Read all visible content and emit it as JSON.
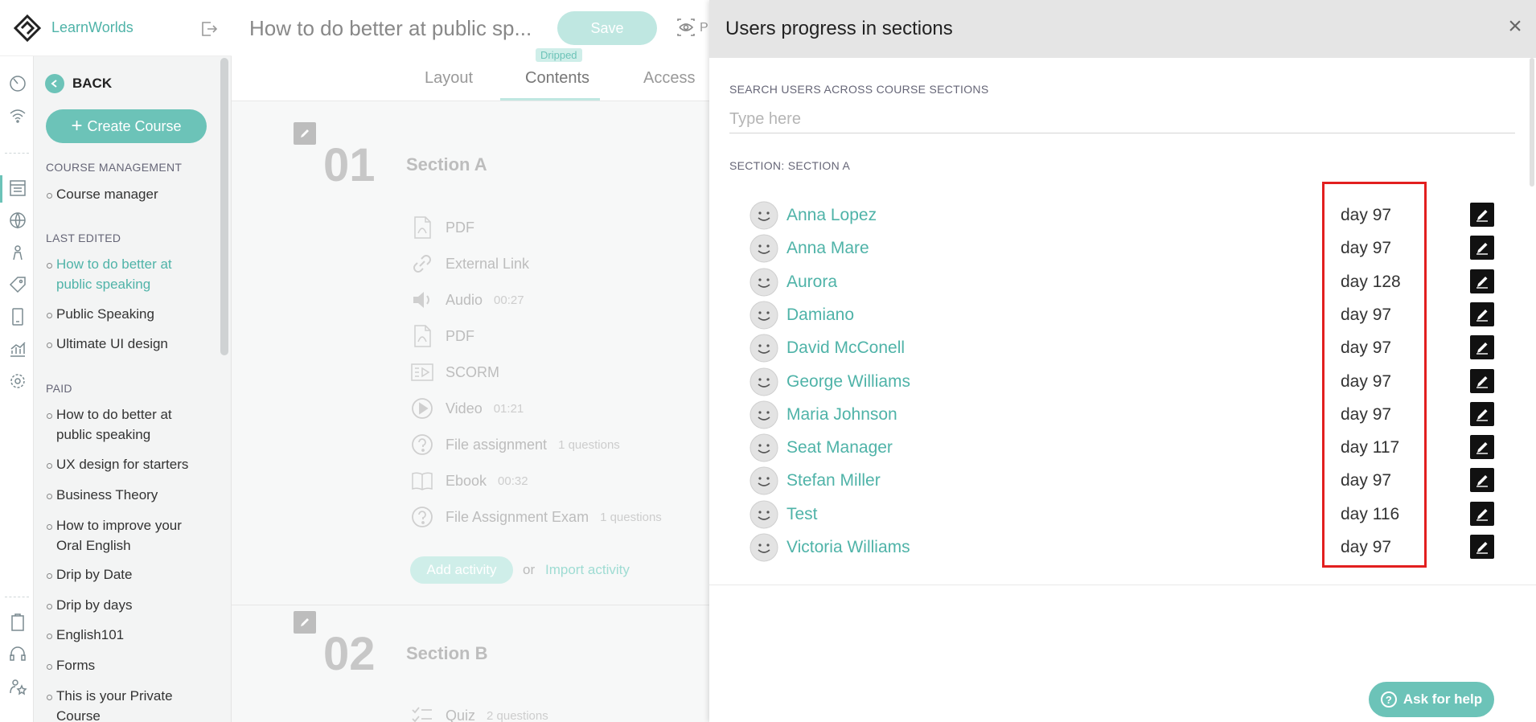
{
  "brand": {
    "name": "LearnWorlds"
  },
  "sidebar": {
    "back_label": "BACK",
    "create_label": "Create Course",
    "sections": [
      {
        "heading": "COURSE MANAGEMENT",
        "items": [
          "Course manager"
        ]
      },
      {
        "heading": "LAST EDITED",
        "items": [
          "How to do better at public speaking",
          "Public Speaking",
          "Ultimate UI design"
        ]
      },
      {
        "heading": "PAID",
        "items": [
          "How to do better at public speaking",
          "UX design for starters",
          "Business Theory",
          "How to improve your Oral English",
          "Drip by Date",
          "Drip by days",
          "English101",
          "Forms",
          "This is your Private Course"
        ]
      }
    ]
  },
  "editor": {
    "course_title": "How to do better at public sp...",
    "save_label": "Save",
    "preview_label": "P",
    "badge": "Dripped",
    "tabs": [
      "Layout",
      "Contents",
      "Access"
    ],
    "section_a": {
      "number": "01",
      "title": "Section A",
      "activities": [
        {
          "icon": "pdf-icon",
          "label": "PDF",
          "meta": ""
        },
        {
          "icon": "link-icon",
          "label": "External Link",
          "meta": ""
        },
        {
          "icon": "audio-icon",
          "label": "Audio",
          "meta": "00:27"
        },
        {
          "icon": "pdf-icon",
          "label": "PDF",
          "meta": ""
        },
        {
          "icon": "scorm-icon",
          "label": "SCORM",
          "meta": ""
        },
        {
          "icon": "video-icon",
          "label": "Video",
          "meta": "01:21"
        },
        {
          "icon": "question-icon",
          "label": "File assignment",
          "meta": "1 questions"
        },
        {
          "icon": "ebook-icon",
          "label": "Ebook",
          "meta": "00:32"
        },
        {
          "icon": "question-icon",
          "label": "File Assignment Exam",
          "meta": "1 questions"
        }
      ],
      "add_label": "Add activity",
      "or_label": "or",
      "import_label": "Import activity"
    },
    "section_b": {
      "number": "02",
      "title": "Section B",
      "first_activity": {
        "icon": "quiz-icon",
        "label": "Quiz",
        "meta": "2 questions"
      }
    }
  },
  "panel": {
    "title": "Users progress in sections",
    "search_label": "SEARCH USERS ACROSS COURSE SECTIONS",
    "search_placeholder": "Type here",
    "search_value": "",
    "section_label": "SECTION: SECTION A",
    "users": [
      {
        "name": "Anna Lopez",
        "day": "day 97"
      },
      {
        "name": "Anna Mare",
        "day": "day 97"
      },
      {
        "name": "Aurora",
        "day": "day 128"
      },
      {
        "name": "Damiano",
        "day": "day 97"
      },
      {
        "name": "David McConell",
        "day": "day 97"
      },
      {
        "name": "George Williams",
        "day": "day 97"
      },
      {
        "name": "Maria Johnson",
        "day": "day 97"
      },
      {
        "name": "Seat Manager",
        "day": "day 117"
      },
      {
        "name": "Stefan Miller",
        "day": "day 97"
      },
      {
        "name": "Test",
        "day": "day 116"
      },
      {
        "name": "Victoria Williams",
        "day": "day 97"
      }
    ],
    "help_label": "Ask for help"
  },
  "colors": {
    "accent": "#6cc3b8",
    "link": "#4fb3a8",
    "highlight": "#e21f1f"
  }
}
